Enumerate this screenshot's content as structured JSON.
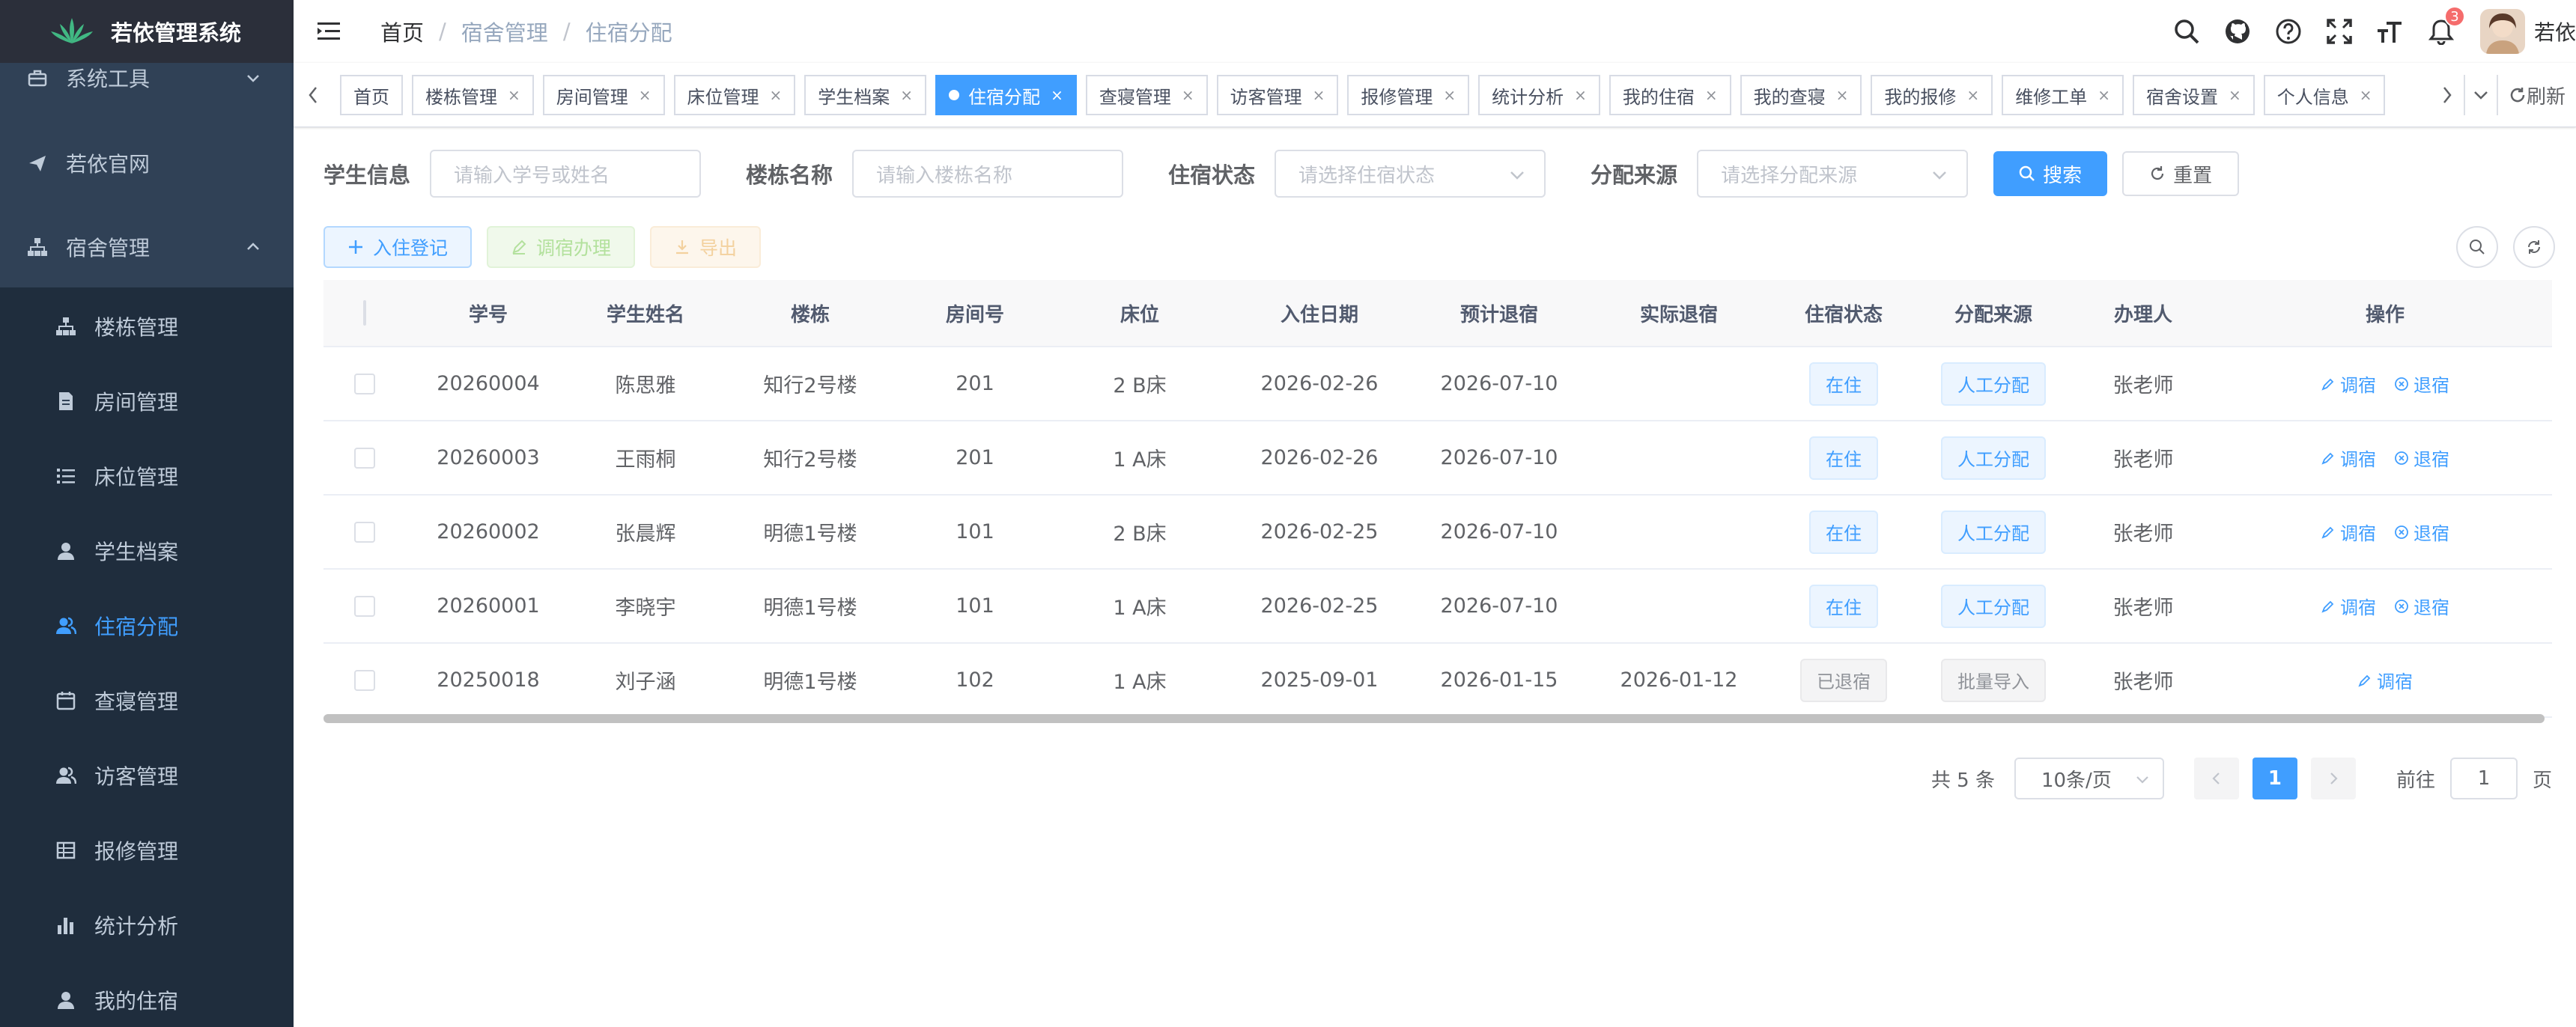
{
  "app": {
    "title": "若依管理系统"
  },
  "sidebar": {
    "items": [
      {
        "label": "系统工具",
        "icon": "toolbox-icon"
      },
      {
        "label": "若依官网",
        "icon": "send-icon"
      },
      {
        "label": "宿舍管理",
        "icon": "tree-icon"
      },
      {
        "label": "楼栋管理",
        "icon": "tree-icon"
      },
      {
        "label": "房间管理",
        "icon": "document-icon"
      },
      {
        "label": "床位管理",
        "icon": "list-icon"
      },
      {
        "label": "学生档案",
        "icon": "user-icon"
      },
      {
        "label": "住宿分配",
        "icon": "peoples-icon"
      },
      {
        "label": "查寝管理",
        "icon": "date-icon"
      },
      {
        "label": "访客管理",
        "icon": "peoples-icon"
      },
      {
        "label": "报修管理",
        "icon": "table-icon"
      },
      {
        "label": "统计分析",
        "icon": "chart-icon"
      },
      {
        "label": "我的住宿",
        "icon": "user-icon"
      }
    ]
  },
  "breadcrumb": {
    "home": "首页",
    "parent": "宿舍管理",
    "current": "住宿分配"
  },
  "header": {
    "notification_count": "3",
    "user_name": "若依"
  },
  "tags": {
    "items": [
      "首页",
      "楼栋管理",
      "房间管理",
      "床位管理",
      "学生档案",
      "住宿分配",
      "查寝管理",
      "访客管理",
      "报修管理",
      "统计分析",
      "我的住宿",
      "我的查寝",
      "我的报修",
      "维修工单",
      "宿舍设置",
      "个人信息"
    ],
    "close_glyph": "×",
    "refresh_label": "刷新"
  },
  "search": {
    "student_label": "学生信息",
    "student_placeholder": "请输入学号或姓名",
    "building_label": "楼栋名称",
    "building_placeholder": "请输入楼栋名称",
    "status_label": "住宿状态",
    "status_placeholder": "请选择住宿状态",
    "source_label": "分配来源",
    "source_placeholder": "请选择分配来源",
    "search_button": "搜索",
    "reset_button": "重置"
  },
  "toolbar": {
    "add_label": "入住登记",
    "adjust_label": "调宿办理",
    "export_label": "导出"
  },
  "table": {
    "columns": [
      "学号",
      "学生姓名",
      "楼栋",
      "房间号",
      "床位",
      "入住日期",
      "预计退宿",
      "实际退宿",
      "住宿状态",
      "分配来源",
      "办理人",
      "操作"
    ],
    "rows": [
      {
        "student_no": "20260004",
        "name": "陈思雅",
        "building": "知行2号楼",
        "room": "201",
        "bed": "2 B床",
        "checkin": "2026-02-26",
        "expected_out": "2026-07-10",
        "actual_out": "",
        "status": "在住",
        "source": "人工分配",
        "handler": "张老师"
      },
      {
        "student_no": "20260003",
        "name": "王雨桐",
        "building": "知行2号楼",
        "room": "201",
        "bed": "1 A床",
        "checkin": "2026-02-26",
        "expected_out": "2026-07-10",
        "actual_out": "",
        "status": "在住",
        "source": "人工分配",
        "handler": "张老师"
      },
      {
        "student_no": "20260002",
        "name": "张晨辉",
        "building": "明德1号楼",
        "room": "101",
        "bed": "2 B床",
        "checkin": "2026-02-25",
        "expected_out": "2026-07-10",
        "actual_out": "",
        "status": "在住",
        "source": "人工分配",
        "handler": "张老师"
      },
      {
        "student_no": "20260001",
        "name": "李晓宇",
        "building": "明德1号楼",
        "room": "101",
        "bed": "1 A床",
        "checkin": "2026-02-25",
        "expected_out": "2026-07-10",
        "actual_out": "",
        "status": "在住",
        "source": "人工分配",
        "handler": "张老师"
      },
      {
        "student_no": "20250018",
        "name": "刘子涵",
        "building": "明德1号楼",
        "room": "102",
        "bed": "1 A床",
        "checkin": "2025-09-01",
        "expected_out": "2026-01-15",
        "actual_out": "2026-01-12",
        "status": "已退宿",
        "source": "批量导入",
        "handler": "张老师"
      }
    ],
    "op_adjust": "调宿",
    "op_checkout": "退宿"
  },
  "pagination": {
    "total": "共 5 条",
    "page_size": "10条/页",
    "current_page": "1",
    "goto_prefix": "前往",
    "goto_value": "1",
    "goto_suffix": "页"
  },
  "colors": {
    "primary": "#409eff",
    "sidebar_bg": "#304156",
    "submenu_bg": "#1f2d3d",
    "sidebar_text": "#bfcbd9"
  }
}
